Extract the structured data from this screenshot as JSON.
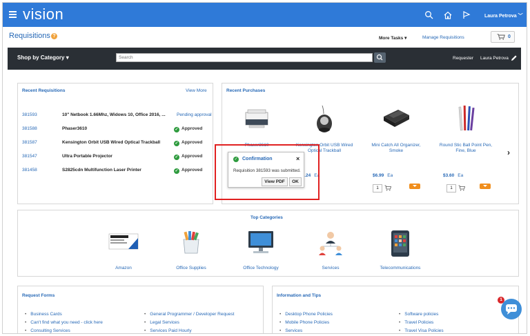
{
  "app": {
    "brand": "vision",
    "user": "Laura Petrova"
  },
  "page": {
    "title": "Requisitions",
    "help": "?",
    "more_tasks": "More Tasks",
    "manage": "Manage Requisitions",
    "cart_count": "0"
  },
  "shop_bar": {
    "category": "Shop by Category",
    "search_placeholder": "Search",
    "requester_label": "Requester",
    "requester_name": "Laura Petrova"
  },
  "recent_requisitions": {
    "title": "Recent Requisitions",
    "view_more": "View More",
    "rows": [
      {
        "number": "381593",
        "description": "10\" Netbook 1.66Mhz, Widows 10, Office 2016, ...",
        "status": "Pending approval"
      },
      {
        "number": "381588",
        "description": "Phaser3610",
        "status": "Approved"
      },
      {
        "number": "381587",
        "description": "Kensington Orbit USB Wired Optical Trackball",
        "status": "Approved"
      },
      {
        "number": "381547",
        "description": "Ultra Portable Projector",
        "status": "Approved"
      },
      {
        "number": "381458",
        "description": "S2825cdn Multifunction Laser Printer",
        "status": "Approved"
      }
    ]
  },
  "recent_purchases": {
    "title": "Recent Purchases",
    "items": [
      {
        "name": "Phaser3610",
        "price": "",
        "uom": "",
        "qty": ""
      },
      {
        "name": "Kensington Orbit USB Wired Optical Trackball",
        "price": "27.24",
        "uom": "Ea",
        "qty": ""
      },
      {
        "name": "Mini Catch All Organizer, Smoke",
        "price": "$6.99",
        "uom": "Ea",
        "qty": "1"
      },
      {
        "name": "Round Stic Ball Point Pen, Fine, Blue",
        "price": "$3.60",
        "uom": "Ea",
        "qty": "1"
      }
    ]
  },
  "confirmation": {
    "title": "Confirmation",
    "message": "Requisition 381593 was submitted.",
    "view_pdf": "View PDF",
    "ok": "OK"
  },
  "top_categories": {
    "title": "Top Categories",
    "items": [
      {
        "label": "Amazon",
        "icon": "amazon-icon"
      },
      {
        "label": "Office Supplies",
        "icon": "office-supplies-icon"
      },
      {
        "label": "Office Technology",
        "icon": "computer-icon"
      },
      {
        "label": "Services",
        "icon": "people-icon"
      },
      {
        "label": "Telecommunications",
        "icon": "phone-icon"
      }
    ]
  },
  "request_forms": {
    "title": "Request Forms",
    "col1": [
      "Business Cards",
      "Can't find what you need - click here",
      "Consulting Services"
    ],
    "col2": [
      "General Programmer / Developer Request",
      "Legal Services",
      "Services Paid Hourly"
    ]
  },
  "info_tips": {
    "title": "Information and Tips",
    "col1": [
      "Desktop Phone Policies",
      "Mobile Phone Policies",
      "Services"
    ],
    "col2": [
      "Software policies",
      "Travel Policies",
      "Travel Visa Policies"
    ]
  },
  "chat": {
    "badge": "1"
  },
  "colors": {
    "brand_blue": "#2f7ad8",
    "link_blue": "#2668b6",
    "approved_green": "#2e9b3e",
    "highlight_red": "#e02020",
    "accent_orange": "#f08e1d"
  }
}
